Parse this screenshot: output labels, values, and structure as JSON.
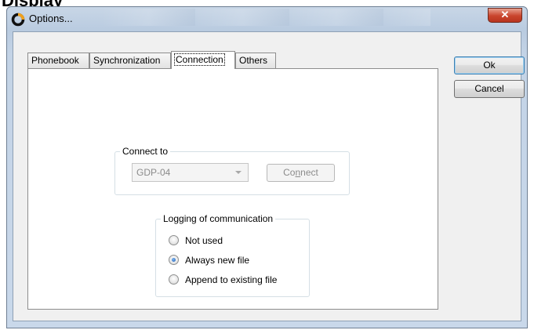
{
  "page": {
    "heading_fragment": "Display"
  },
  "window": {
    "title": "Options...",
    "close_glyph": "✕",
    "icon": "ring-app-icon"
  },
  "tabs": [
    {
      "label": "Phonebook",
      "active": false
    },
    {
      "label": "Synchronization",
      "active": false
    },
    {
      "label": "Connection",
      "active": true
    },
    {
      "label": "Others",
      "active": false
    }
  ],
  "connect_to": {
    "group_title": "Connect to",
    "device_value": "GDP-04",
    "connect_button_pre": "Co",
    "connect_button_mnemonic": "n",
    "connect_button_post": "nect",
    "enabled": false
  },
  "logging": {
    "group_title": "Logging of communication",
    "options": [
      {
        "label": "Not used",
        "checked": false
      },
      {
        "label": "Always new file",
        "checked": true
      },
      {
        "label": "Append to existing file",
        "checked": false
      }
    ]
  },
  "buttons": {
    "ok_label": "Ok",
    "cancel_label": "Cancel"
  },
  "colors": {
    "close_button": "#c9442c",
    "radio_checked": "#1f5fb5",
    "default_button_border": "#3c7fb1"
  }
}
